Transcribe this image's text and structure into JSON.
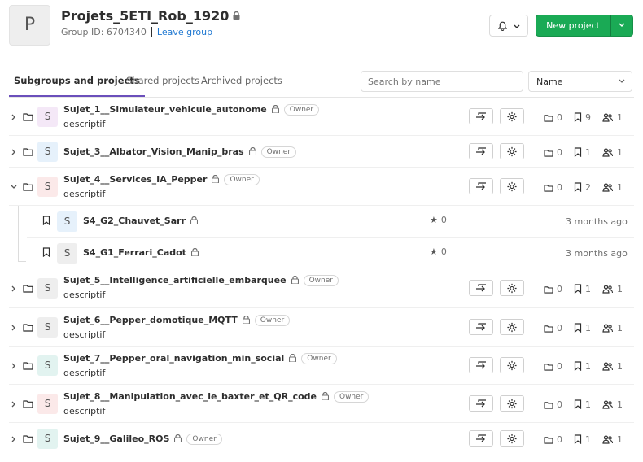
{
  "group": {
    "avatar_letter": "P",
    "name": "Projets_5ETI_Rob_1920",
    "id_text": "Group ID: 6704340",
    "leave_label": "Leave group"
  },
  "header": {
    "new_project_label": "New project"
  },
  "tabs": [
    {
      "label": "Subgroups and projects",
      "active": true
    },
    {
      "label": "Shared projects",
      "active": false
    },
    {
      "label": "Archived projects",
      "active": false
    }
  ],
  "search": {
    "placeholder": "Search by name"
  },
  "sort": {
    "selected": "Name"
  },
  "subgroups": [
    {
      "avatar": "S",
      "avatar_bg": "#f4e8f7",
      "name": "Sujet_1__Simulateur_vehicule_autonome",
      "role": "Owner",
      "description": "descriptif",
      "expanded": false,
      "subgroups_count": "0",
      "projects_count": "9",
      "members_count": "1"
    },
    {
      "avatar": "S",
      "avatar_bg": "#e6f1fb",
      "name": "Sujet_3__Albator_Vision_Manip_bras",
      "role": "Owner",
      "description": "",
      "expanded": false,
      "subgroups_count": "0",
      "projects_count": "1",
      "members_count": "1"
    },
    {
      "avatar": "S",
      "avatar_bg": "#fbe9e9",
      "name": "Sujet_4__Services_IA_Pepper",
      "role": "Owner",
      "description": "descriptif",
      "expanded": true,
      "subgroups_count": "0",
      "projects_count": "2",
      "members_count": "1"
    },
    {
      "avatar": "S",
      "avatar_bg": "#eeeeee",
      "name": "Sujet_5__Intelligence_artificielle_embarquee",
      "role": "Owner",
      "description": "descriptif",
      "expanded": false,
      "subgroups_count": "0",
      "projects_count": "1",
      "members_count": "1"
    },
    {
      "avatar": "S",
      "avatar_bg": "#eeeeee",
      "name": "Sujet_6__Pepper_domotique_MQTT",
      "role": "Owner",
      "description": "descriptif",
      "expanded": false,
      "subgroups_count": "0",
      "projects_count": "1",
      "members_count": "1"
    },
    {
      "avatar": "S",
      "avatar_bg": "#e2f3f0",
      "name": "Sujet_7__Pepper_oral_navigation_min_social",
      "role": "Owner",
      "description": "descriptif",
      "expanded": false,
      "subgroups_count": "0",
      "projects_count": "1",
      "members_count": "1"
    },
    {
      "avatar": "S",
      "avatar_bg": "#fbe9e9",
      "name": "Sujet_8__Manipulation_avec_le_baxter_et_QR_code",
      "role": "Owner",
      "description": "descriptif",
      "expanded": false,
      "subgroups_count": "0",
      "projects_count": "1",
      "members_count": "1"
    },
    {
      "avatar": "S",
      "avatar_bg": "#e2f3f0",
      "name": "Sujet_9__Galileo_ROS",
      "role": "Owner",
      "description": "",
      "expanded": false,
      "subgroups_count": "0",
      "projects_count": "1",
      "members_count": "1"
    }
  ],
  "projects": [
    {
      "avatar": "S",
      "avatar_bg": "#e6f1fb",
      "name": "S4_G2_Chauvet_Sarr",
      "stars": "0",
      "updated": "3 months ago"
    },
    {
      "avatar": "S",
      "avatar_bg": "#eeeeee",
      "name": "S4_G1_Ferrari_Cadot",
      "stars": "0",
      "updated": "3 months ago"
    }
  ],
  "colors": {
    "accent": "#1aaa55",
    "tab_active": "#6b4fbb",
    "link": "#1f78d1"
  }
}
